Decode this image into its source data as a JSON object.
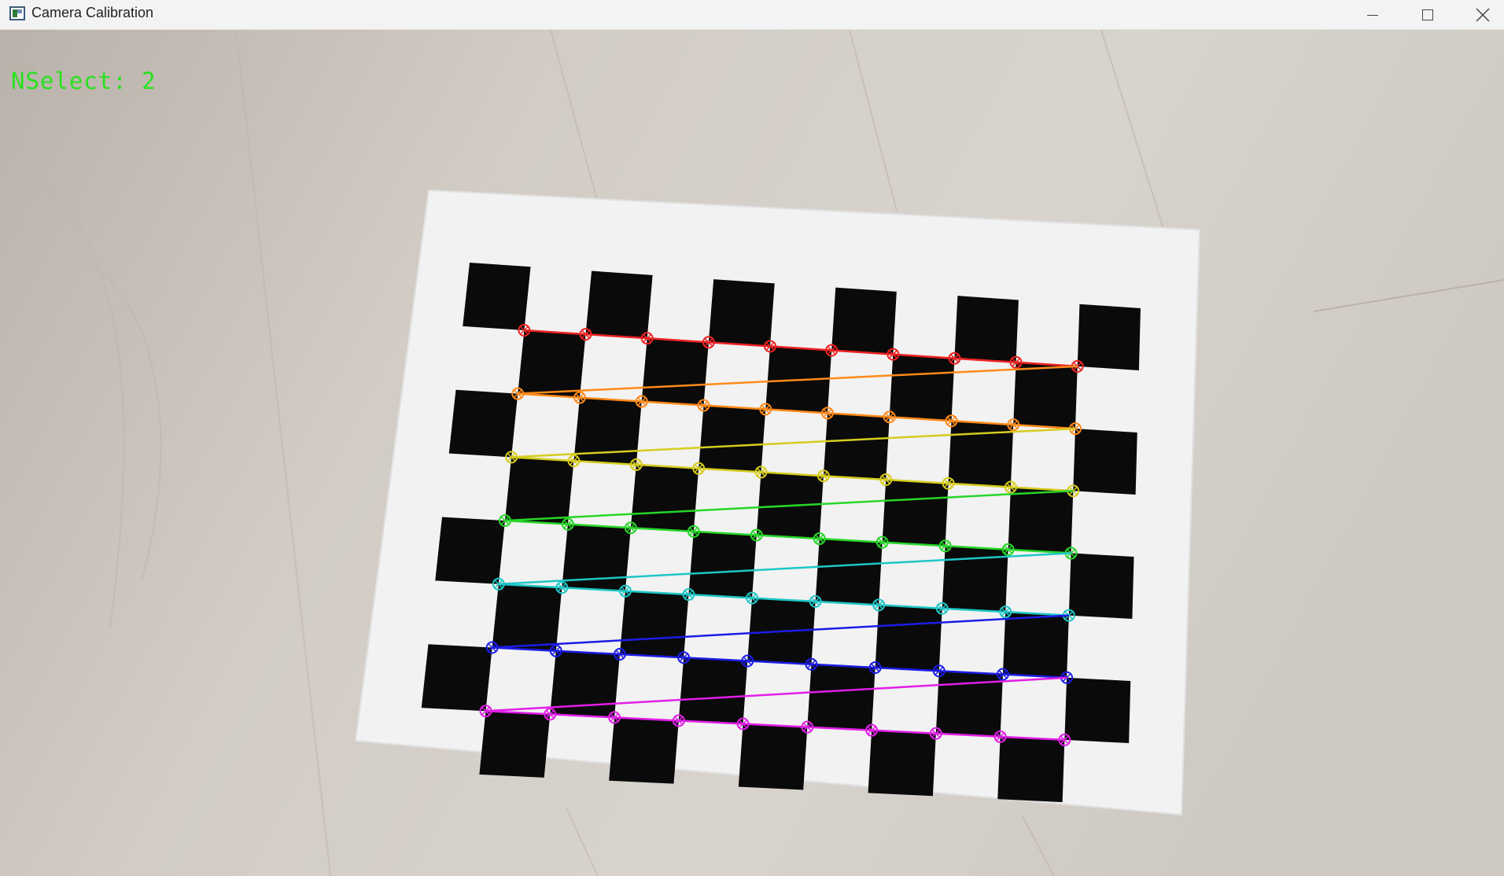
{
  "window": {
    "title": "Camera Calibration",
    "controls": {
      "minimize": "minimize",
      "maximize": "maximize",
      "close": "close"
    }
  },
  "overlay": {
    "nselect_text": "NSelect: 2"
  },
  "colors": {
    "overlay_text": "#27e21c",
    "rows": [
      "#ee2222",
      "#ff8a1a",
      "#d6cc1e",
      "#27d628",
      "#1fc6c6",
      "#1c1ce6",
      "#e21ee6"
    ]
  },
  "chessboard": {
    "inner_corner_rows": 7,
    "inner_corner_cols": 10
  }
}
